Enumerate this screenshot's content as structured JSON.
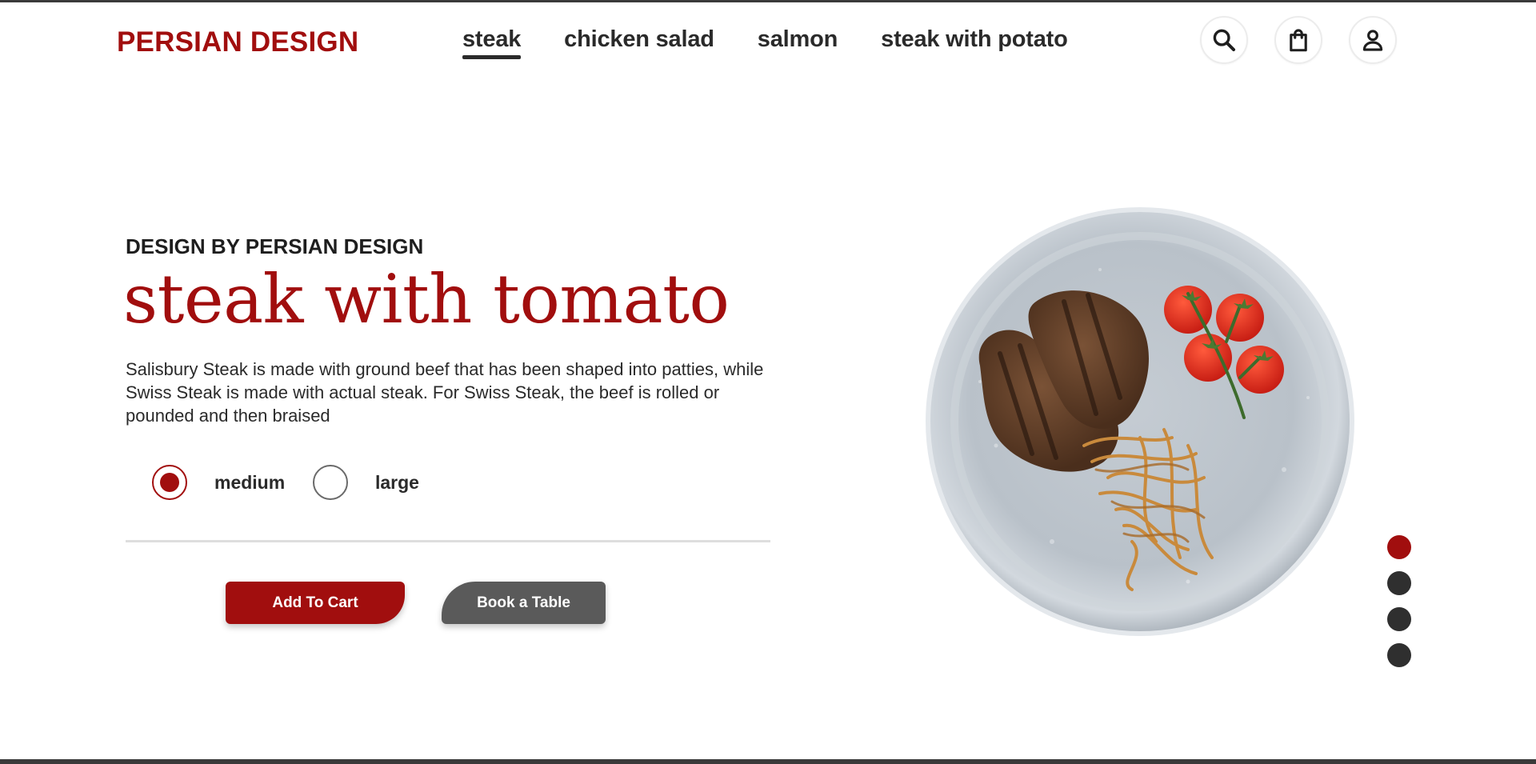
{
  "brand": {
    "name": "PERSIAN DESIGN",
    "accent_color": "#a10e0e"
  },
  "nav": {
    "items": [
      {
        "label": "steak",
        "active": true
      },
      {
        "label": "chicken salad",
        "active": false
      },
      {
        "label": "salmon",
        "active": false
      },
      {
        "label": "steak with potato",
        "active": false
      }
    ]
  },
  "header_icons": [
    "search-icon",
    "shopping-bag-icon",
    "user-icon"
  ],
  "hero": {
    "eyebrow": "DESIGN BY PERSIAN DESIGN",
    "title": "steak with tomato",
    "description": "Salisbury Steak is made with ground beef that has been shaped into patties, while Swiss Steak is made with actual steak. For Swiss Steak, the beef is rolled or pounded and then braised",
    "sizes": [
      {
        "label": "medium",
        "selected": true
      },
      {
        "label": "large",
        "selected": false
      }
    ],
    "add_to_cart_label": "Add To Cart",
    "book_table_label": "Book a Table",
    "image_alt_icon": "steak-plate-image"
  },
  "slider": {
    "total": 4,
    "active_index": 0
  }
}
